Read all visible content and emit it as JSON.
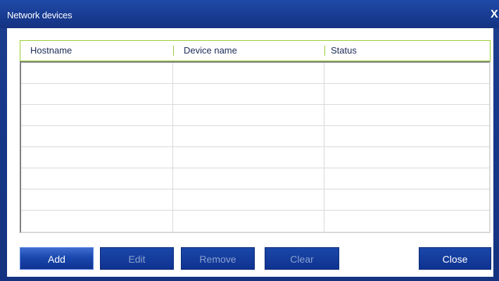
{
  "window": {
    "title": "Network devices",
    "close_glyph": "X"
  },
  "table": {
    "columns": [
      "Hostname",
      "Device name",
      "Status"
    ],
    "rows": [
      [
        "",
        "",
        ""
      ],
      [
        "",
        "",
        ""
      ],
      [
        "",
        "",
        ""
      ],
      [
        "",
        "",
        ""
      ],
      [
        "",
        "",
        ""
      ],
      [
        "",
        "",
        ""
      ],
      [
        "",
        "",
        ""
      ],
      [
        "",
        "",
        ""
      ]
    ]
  },
  "buttons": {
    "add": "Add",
    "edit": "Edit",
    "remove": "Remove",
    "clear": "Clear",
    "close": "Close"
  },
  "colors": {
    "frame": "#143380",
    "button": "#0f3291",
    "header_border": "#9acd32"
  }
}
